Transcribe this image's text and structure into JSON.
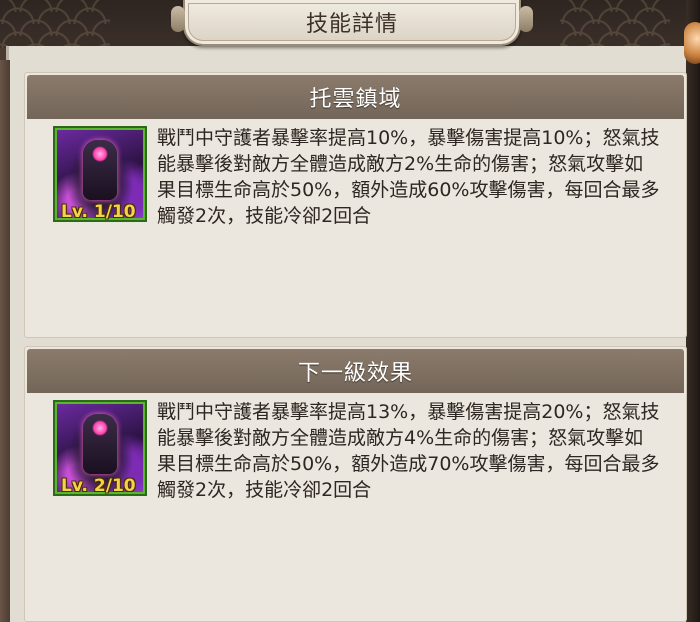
{
  "header": {
    "title": "技能詳情"
  },
  "current_skill": {
    "name": "托雲鎮域",
    "level": "Lv. 1/10",
    "description": "戰鬥中守護者暴擊率提高10%，暴擊傷害提高10%；怒氣技能暴擊後對敵方全體造成敵方2%生命的傷害；怒氣攻擊如果目標生命高於50%，額外造成60%攻擊傷害，每回合最多觸發2次，技能冷卻2回合"
  },
  "next_level": {
    "title": "下一級效果",
    "level": "Lv. 2/10",
    "description": "戰鬥中守護者暴擊率提高13%，暴擊傷害提高20%；怒氣技能暴擊後對敵方全體造成敵方4%生命的傷害；怒氣攻擊如果目標生命高於50%，額外造成70%攻擊傷害，每回合最多觸發2次，技能冷卻2回合"
  },
  "colors": {
    "panel_header": "#7f7062",
    "icon_border": "#5ab52f",
    "level_text": "#f5d24a",
    "paper": "#e2ddd2"
  },
  "icons": {
    "skill_icon": "guardian-skill-icon"
  }
}
